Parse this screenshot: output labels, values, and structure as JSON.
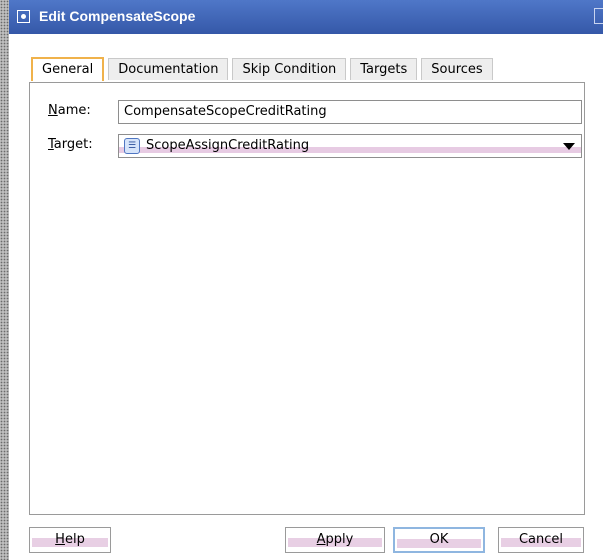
{
  "window": {
    "title": "Edit CompensateScope"
  },
  "tabs": [
    {
      "label": "General",
      "active": true
    },
    {
      "label": "Documentation",
      "active": false
    },
    {
      "label": "Skip Condition",
      "active": false
    },
    {
      "label": "Targets",
      "active": false
    },
    {
      "label": "Sources",
      "active": false
    }
  ],
  "form": {
    "name_label_mnemonic": "N",
    "name_label_rest": "ame:",
    "name_value": "CompensateScopeCreditRating",
    "target_label_mnemonic": "T",
    "target_label_rest": "arget:",
    "target_value": "ScopeAssignCreditRating",
    "target_icon": "scope-icon"
  },
  "buttons": {
    "help_mnemonic": "H",
    "help_rest": "elp",
    "apply_mnemonic": "A",
    "apply_rest": "pply",
    "ok": "OK",
    "cancel": "Cancel"
  },
  "colors": {
    "titlebar": "#3d63b4",
    "active_tab_border": "#f0b24b",
    "field_band": "#e7cbe3"
  }
}
